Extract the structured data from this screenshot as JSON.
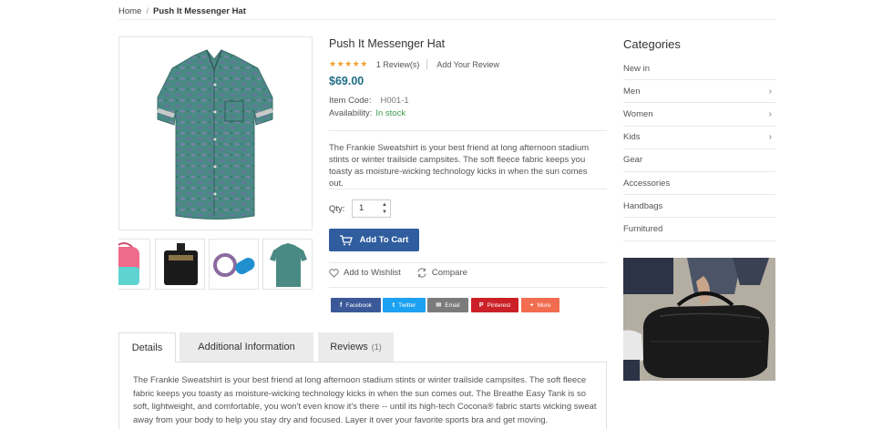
{
  "breadcrumb": {
    "home": "Home",
    "separator": "/",
    "current": "Push It Messenger Hat"
  },
  "product": {
    "title": "Push It Messenger Hat",
    "stars": "★★★★★",
    "rating_fraction": 1.0,
    "reviews_link": "1 Review(s)",
    "add_review": "Add Your Review",
    "price": "$69.00",
    "item_code_label": "Item Code:",
    "item_code": "H001-1",
    "availability_label": "Availability:",
    "availability": "In stock",
    "short_description": "The Frankie Sweatshirt is your best friend at long afternoon stadium stints or winter trailside campsites. The soft fleece fabric keeps you toasty as moisture-wicking technology kicks in when the sun comes out.",
    "qty_label": "Qty:",
    "qty_value": "1",
    "add_to_cart": "Add To Cart",
    "wishlist": "Add to Wishlist",
    "compare": "Compare"
  },
  "share": [
    {
      "label": "Facebook",
      "icon": "f",
      "color": "#3b5998"
    },
    {
      "label": "Twitter",
      "icon": "t",
      "color": "#1da1f2"
    },
    {
      "label": "Email",
      "icon": "✉",
      "color": "#7b7b7b"
    },
    {
      "label": "Pinterest",
      "icon": "P",
      "color": "#cb2027"
    },
    {
      "label": "More",
      "icon": "+",
      "color": "#f26c4f"
    }
  ],
  "tabs": {
    "details": "Details",
    "additional": "Additional Information",
    "reviews": "Reviews",
    "reviews_count": "(1)"
  },
  "details_text": "The Frankie Sweatshirt is your best friend at long afternoon stadium stints or winter trailside campsites. The soft fleece fabric keeps you toasty as moisture-wicking technology kicks in when the sun comes out. The Breathe Easy Tank is so soft, lightweight, and comfortable, you won't even know it's there -- until its high-tech Cocona® fabric starts wicking sweat away from your body to help you stay dry and focused. Layer it over your favorite sports bra and get moving.",
  "sidebar": {
    "title": "Categories",
    "items": [
      {
        "label": "New in",
        "has_children": false
      },
      {
        "label": "Men",
        "has_children": true
      },
      {
        "label": "Women",
        "has_children": true
      },
      {
        "label": "Kids",
        "has_children": true
      },
      {
        "label": "Gear",
        "has_children": false
      },
      {
        "label": "Accessories",
        "has_children": false
      },
      {
        "label": "Handbags",
        "has_children": false
      },
      {
        "label": "Furnitured",
        "has_children": false
      }
    ],
    "chevron": "›"
  }
}
